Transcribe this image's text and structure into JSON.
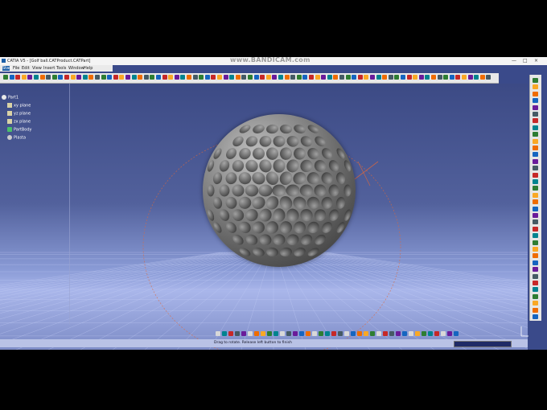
{
  "window": {
    "title": "CATIA V5 - [Golf ball.CATProduct.CATPart]",
    "watermark": "www.BANDICAM.com",
    "controls": {
      "minimize": "—",
      "maximize": "□",
      "close": "×"
    }
  },
  "menu": [
    "Start",
    "File",
    "Edit",
    "View",
    "Insert",
    "Tools",
    "Window",
    "Help"
  ],
  "tree": {
    "root": "Part1",
    "items": [
      {
        "label": "xy plane",
        "icon": "plane-icon"
      },
      {
        "label": "yz plane",
        "icon": "plane-icon"
      },
      {
        "label": "zx plane",
        "icon": "plane-icon"
      },
      {
        "label": "PartBody",
        "icon": "partbody-icon"
      },
      {
        "label": "Plasta",
        "icon": "material-icon"
      }
    ]
  },
  "status": {
    "message": "Drag to rotate. Release left button to finish"
  },
  "colors": {
    "background_top": "#3c4a85",
    "background_horizon": "#a9b6ea",
    "ball": "#7a7a7a",
    "tree_text": "#ffffff",
    "grid": "#c4cdf5",
    "compass": "#e0683a"
  }
}
